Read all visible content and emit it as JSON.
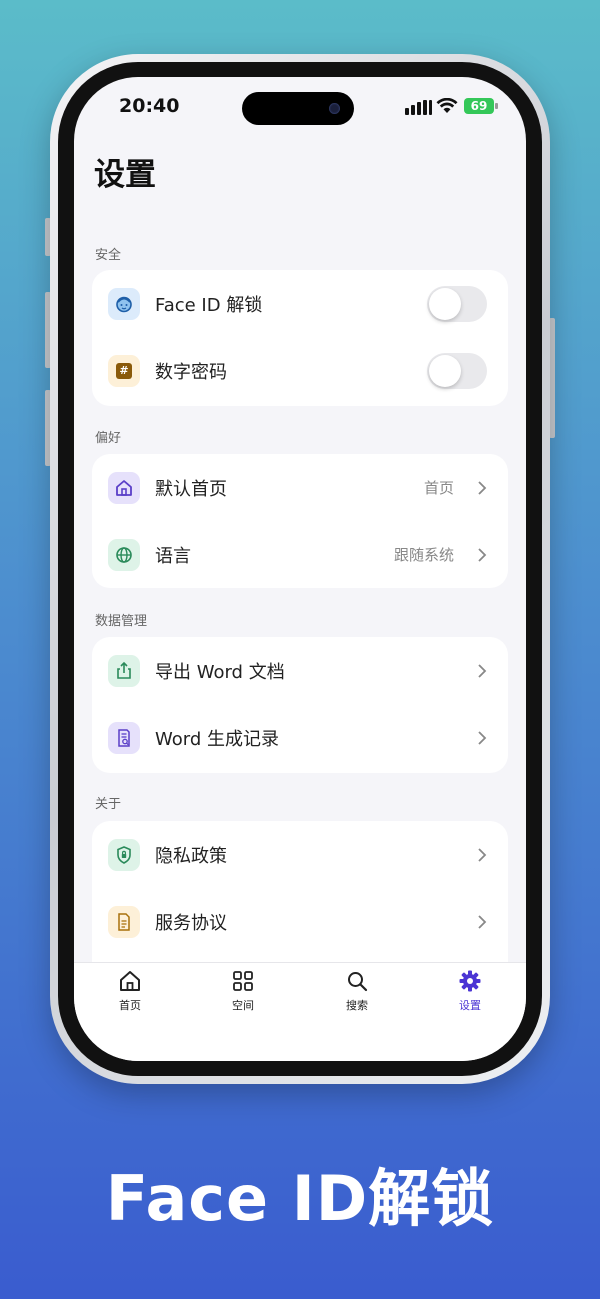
{
  "status_bar": {
    "time": "20:40",
    "battery": "69"
  },
  "header": {
    "title": "设置"
  },
  "sections": {
    "security": {
      "label": "安全",
      "face_id": {
        "label": "Face ID 解锁",
        "enabled": false
      },
      "passcode": {
        "label": "数字密码",
        "enabled": false
      }
    },
    "preferences": {
      "label": "偏好",
      "home": {
        "label": "默认首页",
        "value": "首页"
      },
      "language": {
        "label": "语言",
        "value": "跟随系统"
      }
    },
    "data": {
      "label": "数据管理",
      "export": {
        "label": "导出 Word 文档"
      },
      "history": {
        "label": "Word 生成记录"
      }
    },
    "about": {
      "label": "关于",
      "privacy": {
        "label": "隐私政策"
      },
      "terms": {
        "label": "服务协议"
      }
    }
  },
  "tabbar": {
    "home": "首页",
    "space": "空间",
    "search": "搜索",
    "settings": "设置",
    "active": "settings"
  },
  "colors": {
    "accent": "#4b35d4"
  },
  "promo": {
    "headline": "Face ID解锁"
  }
}
